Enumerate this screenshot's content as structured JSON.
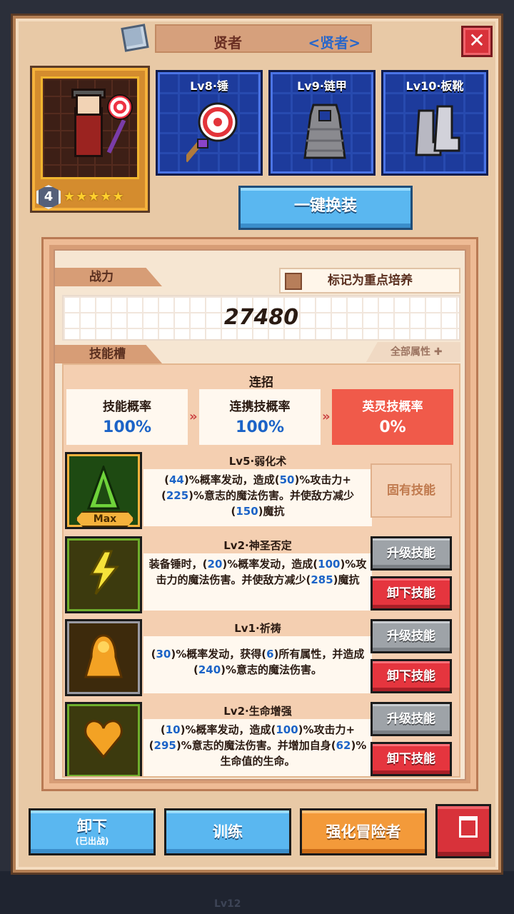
{
  "background": {
    "label": "Lv12"
  },
  "dialog": {
    "title": "贤者",
    "class_tag": "<贤者>",
    "close_icon": "close-icon"
  },
  "hero": {
    "level": "4",
    "stars": "★★★★★"
  },
  "equipment": [
    {
      "label": "Lv8·锤",
      "icon": "lollipop-hammer-icon"
    },
    {
      "label": "Lv9·链甲",
      "icon": "chainmail-icon"
    },
    {
      "label": "Lv10·板靴",
      "icon": "plate-boots-icon"
    }
  ],
  "swap_button": "一键换装",
  "panel": {
    "power_tab": "战力",
    "mark_label": "标记为重点培养",
    "power_value": "27480",
    "skills_tab": "技能槽",
    "all_attributes": "全部属性 ✚"
  },
  "combo": {
    "title": "连招",
    "cards": [
      {
        "label": "技能概率",
        "value": "100%"
      },
      {
        "label": "连携技概率",
        "value": "100%"
      },
      {
        "label": "英灵技概率",
        "value": "0%"
      }
    ],
    "arrow": "»"
  },
  "skills": [
    {
      "name": "Lv5·弱化术",
      "desc_parts": [
        "(",
        "44",
        ")%概率发动，造成(",
        "50",
        ")%攻击力+(",
        "225",
        ")%意志的魔法伤害。并使敌方减少(",
        "150",
        ")魔抗"
      ],
      "badge": "Max",
      "fixed_label": "固有技能"
    },
    {
      "name": "Lv2·神圣否定",
      "desc_parts": [
        "装备锤时，(",
        "20",
        ")%概率发动，造成(",
        "100",
        ")%攻击力的魔法伤害。并使敌方减少(",
        "285",
        ")魔抗"
      ],
      "upgrade_label": "升级技能",
      "remove_label": "卸下技能"
    },
    {
      "name": "Lv1·祈祷",
      "desc_parts": [
        "(",
        "30",
        ")%概率发动，获得(",
        "6",
        ")所有属性，并造成(",
        "240",
        ")%意志的魔法伤害。"
      ],
      "upgrade_label": "升级技能",
      "remove_label": "卸下技能"
    },
    {
      "name": "Lv2·生命增强",
      "desc_parts": [
        "(",
        "10",
        ")%概率发动，造成(",
        "100",
        ")%攻击力+(",
        "295",
        ")%意志的魔法伤害。并增加自身(",
        "62",
        ")%生命值的生命。"
      ],
      "upgrade_label": "升级技能",
      "remove_label": "卸下技能"
    }
  ],
  "bottom": {
    "unequip_label": "卸下",
    "unequip_sub": "(已出战)",
    "train_label": "训练",
    "enhance_label": "强化冒险者",
    "delete_icon": "trash-icon"
  },
  "colors": {
    "accent_blue": "#1b63c7",
    "danger_red": "#e5353e",
    "panel_beige": "#f6e6d2"
  }
}
